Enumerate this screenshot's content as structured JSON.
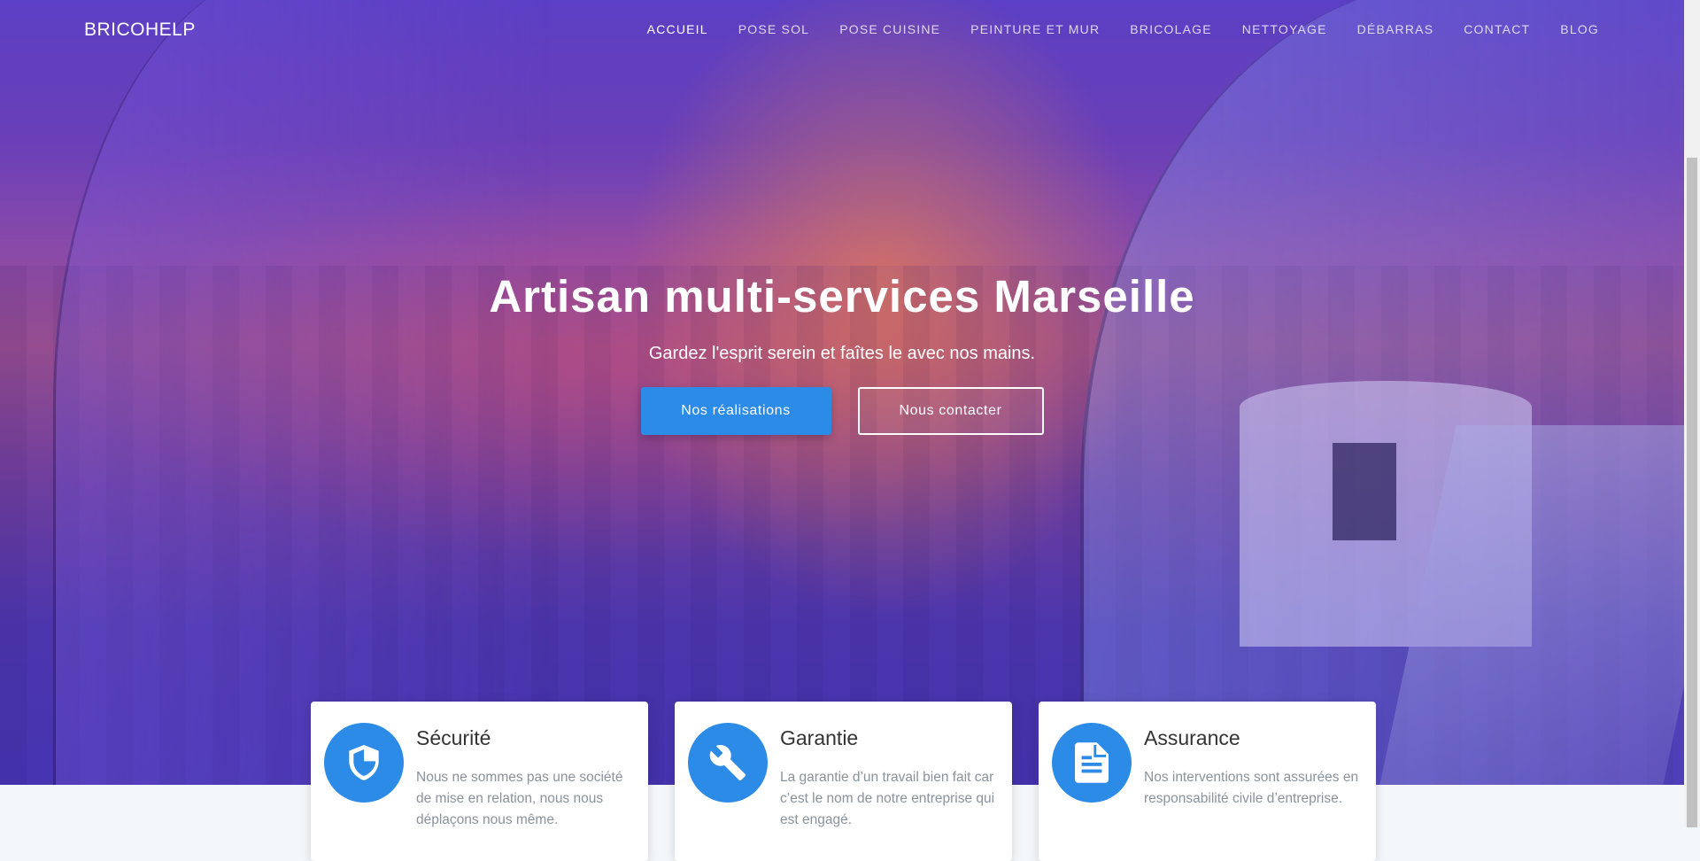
{
  "brand": "BRICOHELP",
  "nav": [
    "ACCUEIL",
    "POSE SOL",
    "POSE CUISINE",
    "PEINTURE ET MUR",
    "BRICOLAGE",
    "NETTOYAGE",
    "DÉBARRAS",
    "CONTACT",
    "BLOG"
  ],
  "hero": {
    "title": "Artisan multi-services Marseille",
    "subtitle": "Gardez l'esprit serein et faîtes le avec nos mains.",
    "primary_button": "Nos réalisations",
    "secondary_button": "Nous contacter"
  },
  "cards": [
    {
      "icon": "shield-icon",
      "title": "Sécurité",
      "text": "Nous ne sommes pas une société de mise en relation, nous nous déplaçons nous même."
    },
    {
      "icon": "wrench-icon",
      "title": "Garantie",
      "text": "La garantie d’un travail bien fait car c’est le nom de notre entreprise qui est engagé."
    },
    {
      "icon": "document-icon",
      "title": "Assurance",
      "text": "Nos interventions sont assurées en responsabilité civile d’entreprise."
    }
  ],
  "colors": {
    "accent": "#2b8be6",
    "overlay": "#5b3fc4"
  }
}
